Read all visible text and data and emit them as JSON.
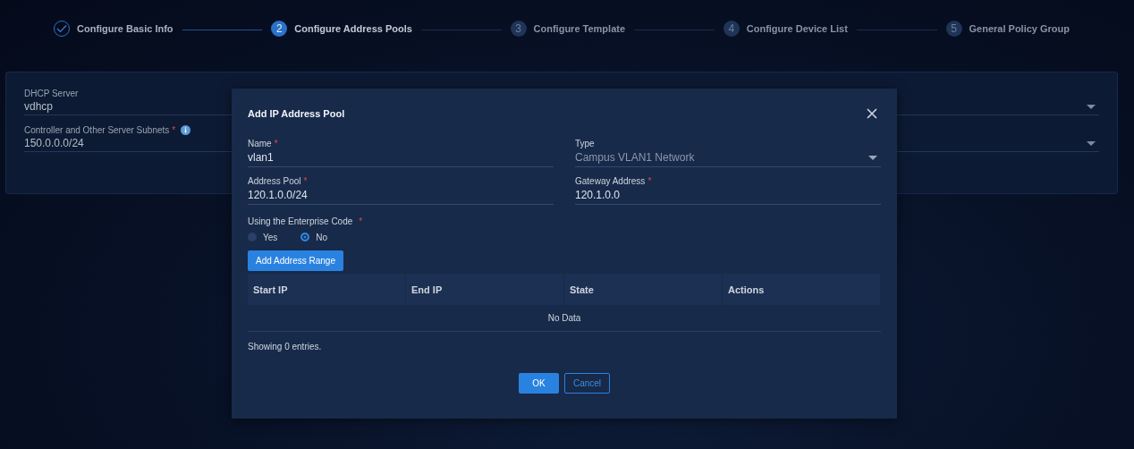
{
  "steps": [
    {
      "label": "Configure Basic Info",
      "done": true,
      "active": false
    },
    {
      "number": "2",
      "label": "Configure Address Pools",
      "done": false,
      "active": true
    },
    {
      "number": "3",
      "label": "Configure Template",
      "done": false,
      "active": false
    },
    {
      "number": "4",
      "label": "Configure Device List",
      "done": false,
      "active": false
    },
    {
      "number": "5",
      "label": "General Policy Group",
      "done": false,
      "active": false
    }
  ],
  "background_form": {
    "fields": [
      {
        "label": "DHCP Server",
        "value": "vdhcp",
        "kind": "select"
      },
      {
        "label": "Controller and Other Server Subnets",
        "required_mark": "*",
        "info": true,
        "value": "150.0.0.0/24",
        "kind": "select"
      }
    ]
  },
  "dialog": {
    "title": "Add IP Address Pool",
    "fields": [
      {
        "label": "Name",
        "required_mark": "*",
        "value": "vlan1",
        "kind": "text"
      },
      {
        "label": "Type",
        "value": "Campus VLAN1 Network",
        "kind": "select"
      },
      {
        "label": "Address Pool",
        "required_mark": "*",
        "value": "120.1.0.0/24",
        "kind": "text"
      },
      {
        "label": "Gateway Address",
        "required_mark": "*",
        "value": "120.1.0.0",
        "kind": "text"
      }
    ],
    "radio_group": {
      "label": "Using the Enterprise Code",
      "required_mark": "*",
      "options": [
        {
          "label": "Yes",
          "selected": false
        },
        {
          "label": "No",
          "selected": true
        }
      ]
    },
    "add_button": "Add Address Range",
    "table": {
      "columns": [
        "Start IP",
        "End IP",
        "State",
        "Actions"
      ],
      "empty_text": "No Data"
    },
    "footer_text": "Showing 0 entries.",
    "buttons": [
      {
        "label": "OK",
        "kind": "primary"
      },
      {
        "label": "Cancel",
        "kind": "secondary"
      }
    ]
  }
}
